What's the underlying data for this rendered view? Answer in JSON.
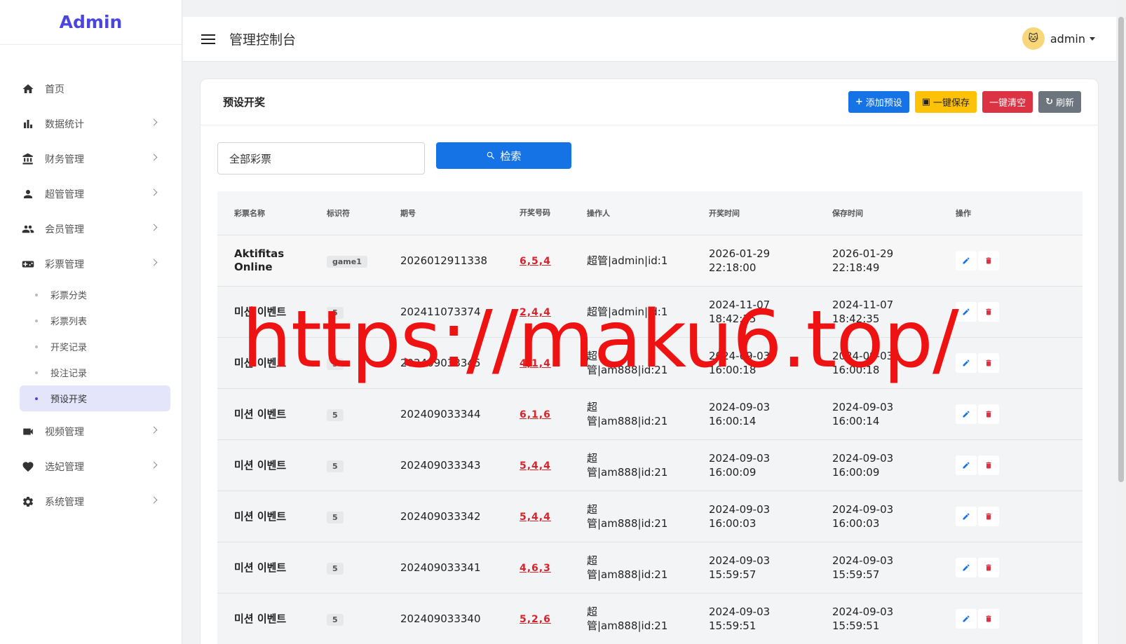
{
  "brand": "Admin",
  "sidebar": {
    "items": [
      {
        "label": "首页"
      },
      {
        "label": "数据统计"
      },
      {
        "label": "财务管理"
      },
      {
        "label": "超管管理"
      },
      {
        "label": "会员管理"
      },
      {
        "label": "彩票管理"
      },
      {
        "label": "视频管理"
      },
      {
        "label": "选妃管理"
      },
      {
        "label": "系统管理"
      }
    ],
    "lottery_sub": [
      {
        "label": "彩票分类"
      },
      {
        "label": "彩票列表"
      },
      {
        "label": "开奖记录"
      },
      {
        "label": "投注记录"
      },
      {
        "label": "预设开奖"
      }
    ]
  },
  "header": {
    "title": "管理控制台",
    "user": "admin"
  },
  "card": {
    "title": "预设开奖",
    "buttons": {
      "add": "添加预设",
      "save": "一键保存",
      "clear": "一键清空",
      "refresh": "刷新"
    }
  },
  "search": {
    "select_value": "全部彩票",
    "button": "检索"
  },
  "table": {
    "headers": [
      "彩票名称",
      "标识符",
      "期号",
      "开奖号码",
      "操作人",
      "开奖时间",
      "保存时间",
      "操作"
    ],
    "rows": [
      {
        "name": "Aktifitas Online",
        "tag": "game1",
        "issue": "2026012911338",
        "nums": "6,5,4",
        "op": "超管|admin|id:1",
        "draw_date": "2026-01-29",
        "draw_time": "22:18:00",
        "save_date": "2026-01-29",
        "save_time": "22:18:49"
      },
      {
        "name": "미션 이벤트",
        "tag": "5",
        "issue": "202411073374",
        "nums": "2,4,4",
        "op": "超管|admin|id:1",
        "draw_date": "2024-11-07",
        "draw_time": "18:42:35",
        "save_date": "2024-11-07",
        "save_time": "18:42:35"
      },
      {
        "name": "미션 이벤트",
        "tag": "5",
        "issue": "202409033345",
        "nums": "4,1,4",
        "op": "超管|am888|id:21",
        "draw_date": "2024-09-03",
        "draw_time": "16:00:18",
        "save_date": "2024-09-03",
        "save_time": "16:00:18"
      },
      {
        "name": "미션 이벤트",
        "tag": "5",
        "issue": "202409033344",
        "nums": "6,1,6",
        "op": "超管|am888|id:21",
        "draw_date": "2024-09-03",
        "draw_time": "16:00:14",
        "save_date": "2024-09-03",
        "save_time": "16:00:14"
      },
      {
        "name": "미션 이벤트",
        "tag": "5",
        "issue": "202409033343",
        "nums": "5,4,4",
        "op": "超管|am888|id:21",
        "draw_date": "2024-09-03",
        "draw_time": "16:00:09",
        "save_date": "2024-09-03",
        "save_time": "16:00:09"
      },
      {
        "name": "미션 이벤트",
        "tag": "5",
        "issue": "202409033342",
        "nums": "5,4,4",
        "op": "超管|am888|id:21",
        "draw_date": "2024-09-03",
        "draw_time": "16:00:03",
        "save_date": "2024-09-03",
        "save_time": "16:00:03"
      },
      {
        "name": "미션 이벤트",
        "tag": "5",
        "issue": "202409033341",
        "nums": "4,6,3",
        "op": "超管|am888|id:21",
        "draw_date": "2024-09-03",
        "draw_time": "15:59:57",
        "save_date": "2024-09-03",
        "save_time": "15:59:57"
      },
      {
        "name": "미션 이벤트",
        "tag": "5",
        "issue": "202409033340",
        "nums": "5,2,6",
        "op": "超管|am888|id:21",
        "draw_date": "2024-09-03",
        "draw_time": "15:59:51",
        "save_date": "2024-09-03",
        "save_time": "15:59:51"
      }
    ]
  },
  "watermark": "https://maku6.top/",
  "colors": {
    "brand": "#4b46dd",
    "primary": "#1673e6",
    "warning": "#fdc107",
    "danger": "#dc3344",
    "secondary": "#6c757d",
    "draw_numbers": "#d5242b"
  }
}
